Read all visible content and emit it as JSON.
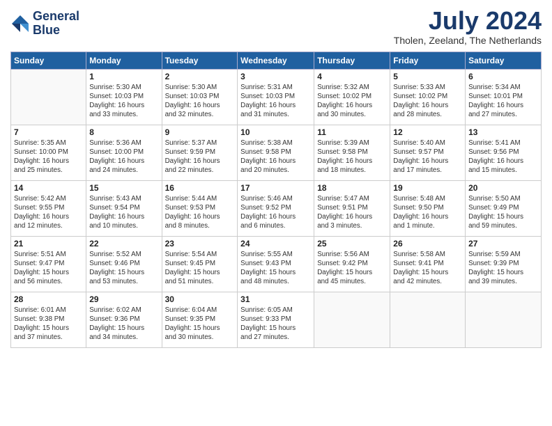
{
  "header": {
    "logo_line1": "General",
    "logo_line2": "Blue",
    "month_title": "July 2024",
    "location": "Tholen, Zeeland, The Netherlands"
  },
  "weekdays": [
    "Sunday",
    "Monday",
    "Tuesday",
    "Wednesday",
    "Thursday",
    "Friday",
    "Saturday"
  ],
  "weeks": [
    [
      {
        "day": "",
        "info": ""
      },
      {
        "day": "1",
        "info": "Sunrise: 5:30 AM\nSunset: 10:03 PM\nDaylight: 16 hours\nand 33 minutes."
      },
      {
        "day": "2",
        "info": "Sunrise: 5:30 AM\nSunset: 10:03 PM\nDaylight: 16 hours\nand 32 minutes."
      },
      {
        "day": "3",
        "info": "Sunrise: 5:31 AM\nSunset: 10:03 PM\nDaylight: 16 hours\nand 31 minutes."
      },
      {
        "day": "4",
        "info": "Sunrise: 5:32 AM\nSunset: 10:02 PM\nDaylight: 16 hours\nand 30 minutes."
      },
      {
        "day": "5",
        "info": "Sunrise: 5:33 AM\nSunset: 10:02 PM\nDaylight: 16 hours\nand 28 minutes."
      },
      {
        "day": "6",
        "info": "Sunrise: 5:34 AM\nSunset: 10:01 PM\nDaylight: 16 hours\nand 27 minutes."
      }
    ],
    [
      {
        "day": "7",
        "info": "Sunrise: 5:35 AM\nSunset: 10:00 PM\nDaylight: 16 hours\nand 25 minutes."
      },
      {
        "day": "8",
        "info": "Sunrise: 5:36 AM\nSunset: 10:00 PM\nDaylight: 16 hours\nand 24 minutes."
      },
      {
        "day": "9",
        "info": "Sunrise: 5:37 AM\nSunset: 9:59 PM\nDaylight: 16 hours\nand 22 minutes."
      },
      {
        "day": "10",
        "info": "Sunrise: 5:38 AM\nSunset: 9:58 PM\nDaylight: 16 hours\nand 20 minutes."
      },
      {
        "day": "11",
        "info": "Sunrise: 5:39 AM\nSunset: 9:58 PM\nDaylight: 16 hours\nand 18 minutes."
      },
      {
        "day": "12",
        "info": "Sunrise: 5:40 AM\nSunset: 9:57 PM\nDaylight: 16 hours\nand 17 minutes."
      },
      {
        "day": "13",
        "info": "Sunrise: 5:41 AM\nSunset: 9:56 PM\nDaylight: 16 hours\nand 15 minutes."
      }
    ],
    [
      {
        "day": "14",
        "info": "Sunrise: 5:42 AM\nSunset: 9:55 PM\nDaylight: 16 hours\nand 12 minutes."
      },
      {
        "day": "15",
        "info": "Sunrise: 5:43 AM\nSunset: 9:54 PM\nDaylight: 16 hours\nand 10 minutes."
      },
      {
        "day": "16",
        "info": "Sunrise: 5:44 AM\nSunset: 9:53 PM\nDaylight: 16 hours\nand 8 minutes."
      },
      {
        "day": "17",
        "info": "Sunrise: 5:46 AM\nSunset: 9:52 PM\nDaylight: 16 hours\nand 6 minutes."
      },
      {
        "day": "18",
        "info": "Sunrise: 5:47 AM\nSunset: 9:51 PM\nDaylight: 16 hours\nand 3 minutes."
      },
      {
        "day": "19",
        "info": "Sunrise: 5:48 AM\nSunset: 9:50 PM\nDaylight: 16 hours\nand 1 minute."
      },
      {
        "day": "20",
        "info": "Sunrise: 5:50 AM\nSunset: 9:49 PM\nDaylight: 15 hours\nand 59 minutes."
      }
    ],
    [
      {
        "day": "21",
        "info": "Sunrise: 5:51 AM\nSunset: 9:47 PM\nDaylight: 15 hours\nand 56 minutes."
      },
      {
        "day": "22",
        "info": "Sunrise: 5:52 AM\nSunset: 9:46 PM\nDaylight: 15 hours\nand 53 minutes."
      },
      {
        "day": "23",
        "info": "Sunrise: 5:54 AM\nSunset: 9:45 PM\nDaylight: 15 hours\nand 51 minutes."
      },
      {
        "day": "24",
        "info": "Sunrise: 5:55 AM\nSunset: 9:43 PM\nDaylight: 15 hours\nand 48 minutes."
      },
      {
        "day": "25",
        "info": "Sunrise: 5:56 AM\nSunset: 9:42 PM\nDaylight: 15 hours\nand 45 minutes."
      },
      {
        "day": "26",
        "info": "Sunrise: 5:58 AM\nSunset: 9:41 PM\nDaylight: 15 hours\nand 42 minutes."
      },
      {
        "day": "27",
        "info": "Sunrise: 5:59 AM\nSunset: 9:39 PM\nDaylight: 15 hours\nand 39 minutes."
      }
    ],
    [
      {
        "day": "28",
        "info": "Sunrise: 6:01 AM\nSunset: 9:38 PM\nDaylight: 15 hours\nand 37 minutes."
      },
      {
        "day": "29",
        "info": "Sunrise: 6:02 AM\nSunset: 9:36 PM\nDaylight: 15 hours\nand 34 minutes."
      },
      {
        "day": "30",
        "info": "Sunrise: 6:04 AM\nSunset: 9:35 PM\nDaylight: 15 hours\nand 30 minutes."
      },
      {
        "day": "31",
        "info": "Sunrise: 6:05 AM\nSunset: 9:33 PM\nDaylight: 15 hours\nand 27 minutes."
      },
      {
        "day": "",
        "info": ""
      },
      {
        "day": "",
        "info": ""
      },
      {
        "day": "",
        "info": ""
      }
    ]
  ]
}
